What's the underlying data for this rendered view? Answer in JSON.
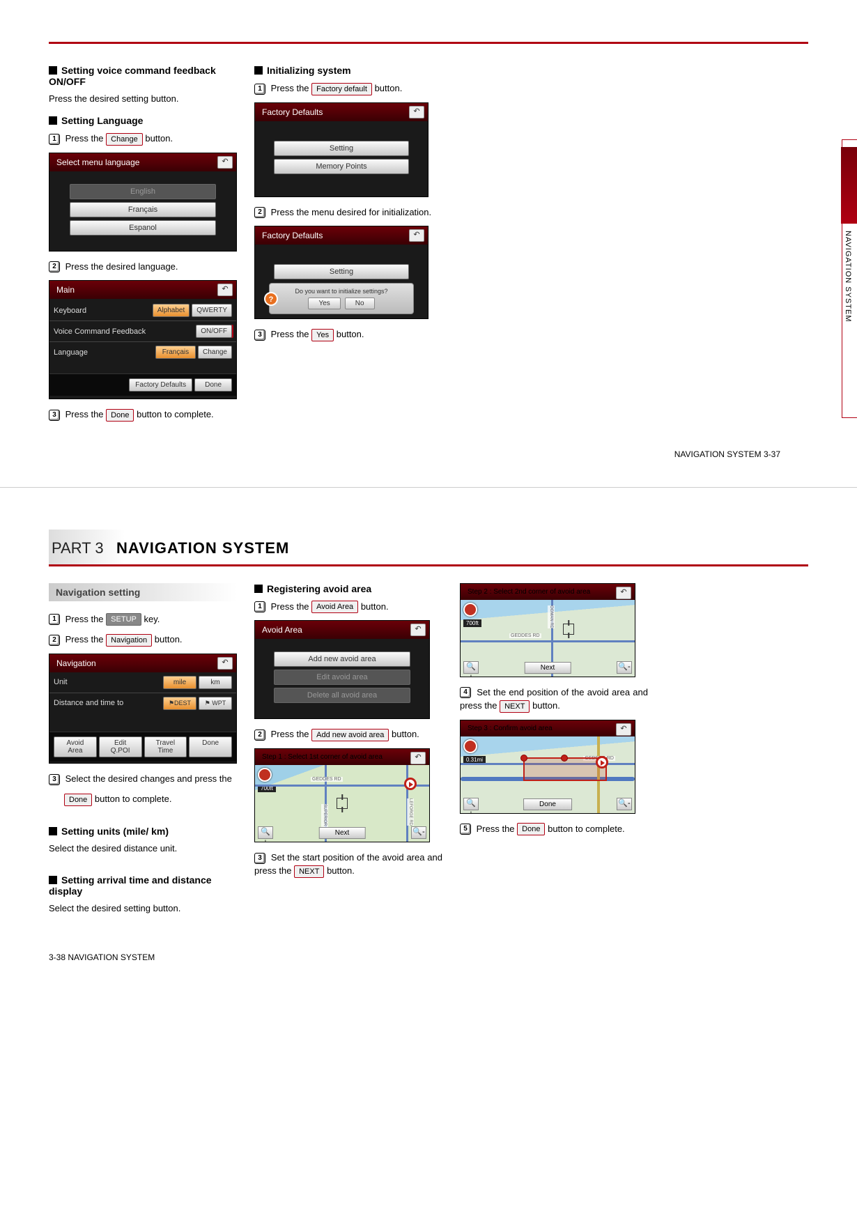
{
  "page1": {
    "col1": {
      "voice_heading": "Setting voice command feedback ON/OFF",
      "voice_text": "Press the desired setting button.",
      "lang_heading": "Setting Language",
      "lang_step1": "Press the",
      "lang_step1_btn": "Change",
      "lang_step1_tail": "button.",
      "ss_lang": {
        "title": "Select menu language",
        "opts": [
          "English",
          "Français",
          "Espanol"
        ]
      },
      "lang_step2": "Press the desired language.",
      "ss_main": {
        "title": "Main",
        "row1_label": "Keyboard",
        "row1_a": "Alphabet",
        "row1_b": "QWERTY",
        "row2_label": "Voice Command Feedback",
        "row2_btn": "ON/OFF",
        "row3_label": "Language",
        "row3_val": "Français",
        "row3_btn": "Change",
        "btm_a": "Factory Defaults",
        "btm_b": "Done"
      },
      "lang_step3_a": "Press the",
      "lang_step3_btn": "Done",
      "lang_step3_b": "button to complete."
    },
    "col2": {
      "init_heading": "Initializing system",
      "init_step1_a": "Press the",
      "init_step1_btn": "Factory default",
      "init_step1_b": "button.",
      "ss_fd1": {
        "title": "Factory Defaults",
        "btn1": "Setting",
        "btn2": "Memory Points"
      },
      "init_step2": "Press the menu desired for initialization.",
      "ss_fd2": {
        "title": "Factory Defaults",
        "btn1": "Setting",
        "dlg_text": "Do you want to initialize settings?",
        "dlg_yes": "Yes",
        "dlg_no": "No"
      },
      "init_step3_a": "Press the",
      "init_step3_btn": "Yes",
      "init_step3_b": "button."
    },
    "pagenum": "NAVIGATION SYSTEM    3-37",
    "sidetab": "NAVIGATION SYSTEM"
  },
  "page2": {
    "part_label": "PART 3",
    "part_title": "NAVIGATION SYSTEM",
    "col1": {
      "sub_heading": "Navigation setting",
      "step1_a": "Press the",
      "step1_btn": "SETUP",
      "step1_b": "key.",
      "step2_a": "Press the",
      "step2_btn": "Navigation",
      "step2_b": "button.",
      "ss_nav": {
        "title": "Navigation",
        "row1_label": "Unit",
        "row1_a": "mile",
        "row1_b": "km",
        "row2_label": "Distance and time to",
        "row2_a": "DEST",
        "row2_b": "WPT",
        "btm": [
          "Avoid Area",
          "Edit Q.POI",
          "Travel Time",
          "Done"
        ]
      },
      "step3_a": "Select the desired changes and press the",
      "step3_btn": "Done",
      "step3_b": "button to complete.",
      "units_head": "Setting units (mile/ km)",
      "units_text": "Select the desired distance unit.",
      "arrival_head": "Setting arrival time and distance display",
      "arrival_text": "Select the desired setting button."
    },
    "col2": {
      "avoid_head": "Registering avoid area",
      "step1_a": "Press the",
      "step1_btn": "Avoid Area",
      "step1_b": "button.",
      "ss_avoid": {
        "title": "Avoid Area",
        "btn1": "Add new avoid area",
        "btn2": "Edit avoid area",
        "btn3": "Delete all avoid area"
      },
      "step2_a": "Press the",
      "step2_btn": "Add new avoid area",
      "step2_b": "button.",
      "ss_map1": {
        "title": "Step 1 : Select 1st corner of avoid area",
        "scale": "700ft",
        "road1": "GEDDES RD",
        "road2": "SUPERIOR RD",
        "road3": "LEFORGE RD",
        "next": "Next"
      },
      "step3_a": "Set the start position of the avoid area and press the",
      "step3_btn": "NEXT",
      "step3_b": "button."
    },
    "col3": {
      "ss_map2": {
        "title": "Step 2 : Select 2nd corner of avoid area",
        "scale": "700ft",
        "road1": "GEDDES RD",
        "road2": "OGMAN RD",
        "next": "Next"
      },
      "step4_a": "Set the end position of the avoid area and press the",
      "step4_btn": "NEXT",
      "step4_b": "button.",
      "ss_map3": {
        "title": "Step 3 : Confirm avoid area",
        "scale": "0.31mi",
        "road1": "GEDDES RD",
        "done": "Done"
      },
      "step5_a": "Press the",
      "step5_btn": "Done",
      "step5_b": "button to complete."
    },
    "pagenum": "3-38   NAVIGATION SYSTEM"
  }
}
